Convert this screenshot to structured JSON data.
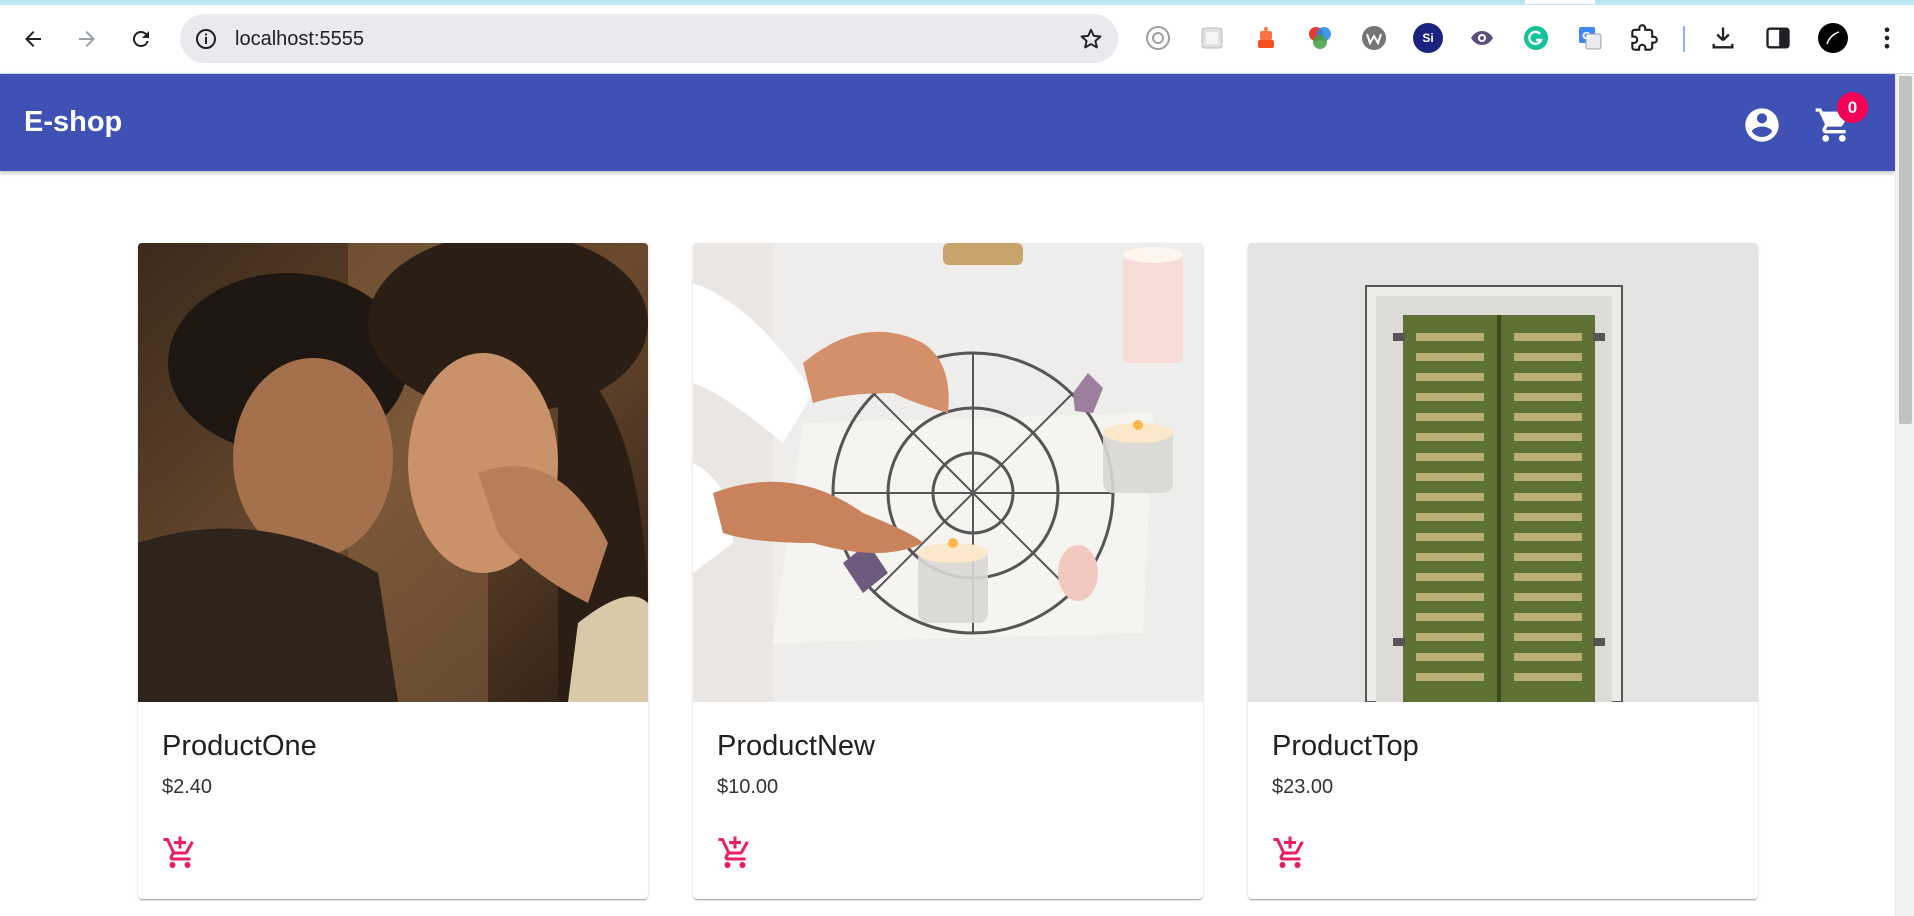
{
  "browser": {
    "url": "localhost:5555"
  },
  "appbar": {
    "title": "E-shop",
    "cart_count": "0",
    "color": "#3f51b5",
    "badge_color": "#f50057"
  },
  "products": [
    {
      "name": "ProductOne",
      "price": "$2.40",
      "icon": "cart-plus-icon"
    },
    {
      "name": "ProductNew",
      "price": "$10.00",
      "icon": "cart-plus-icon"
    },
    {
      "name": "ProductTop",
      "price": "$23.00",
      "icon": "cart-plus-icon"
    }
  ],
  "accent_color": "#e91e63"
}
